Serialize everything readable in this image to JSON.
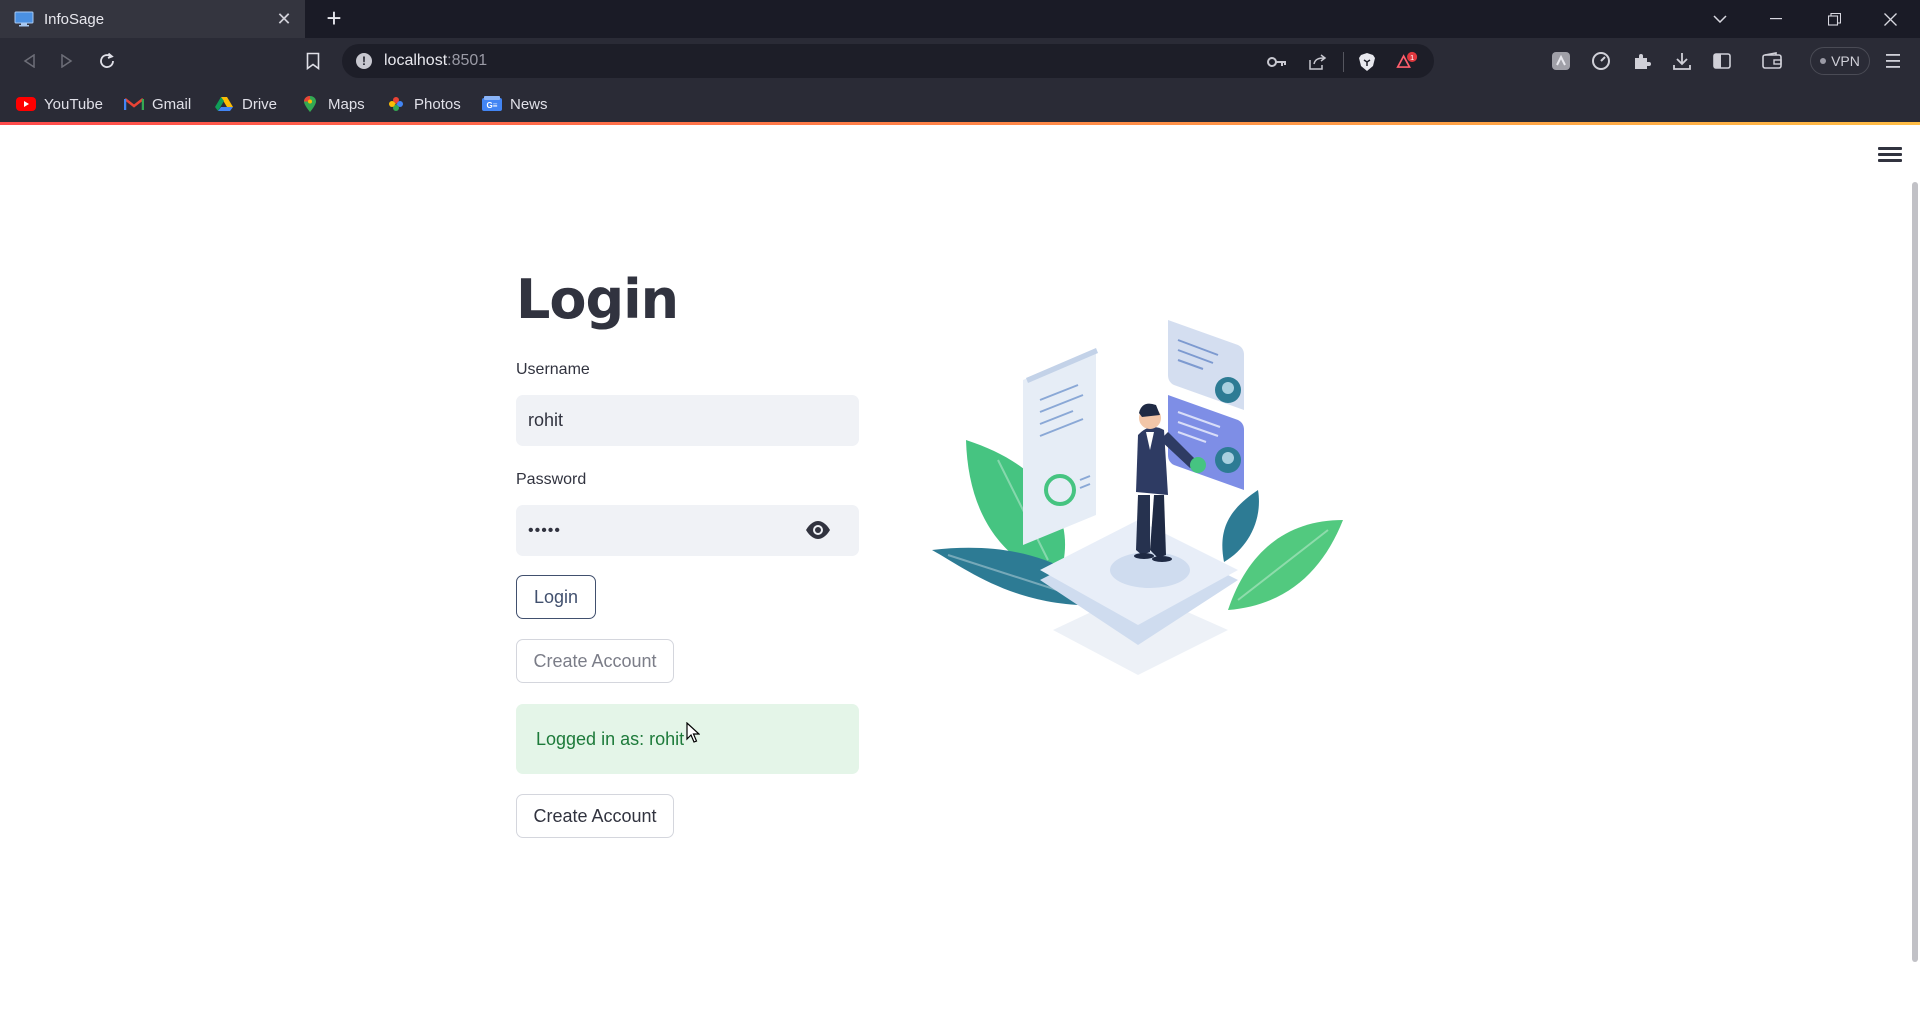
{
  "browser": {
    "tab_title": "InfoSage",
    "tab_close": "✕",
    "new_tab": "+",
    "url_host": "localhost",
    "url_port": ":8501",
    "vpn_label": "VPN",
    "shields_badge": "1"
  },
  "bookmarks": [
    {
      "label": "YouTube",
      "icon": "youtube-icon"
    },
    {
      "label": "Gmail",
      "icon": "gmail-icon"
    },
    {
      "label": "Drive",
      "icon": "drive-icon"
    },
    {
      "label": "Maps",
      "icon": "maps-icon"
    },
    {
      "label": "Photos",
      "icon": "photos-icon"
    },
    {
      "label": "News",
      "icon": "news-icon"
    }
  ],
  "login": {
    "title": "Login",
    "username_label": "Username",
    "username_value": "rohit",
    "password_label": "Password",
    "password_value": "•••••",
    "login_button": "Login",
    "create_account_button": "Create Account",
    "success_message": "Logged in as: rohit",
    "create_account_button_2": "Create Account"
  },
  "colors": {
    "accent_red": "#ff4b4b",
    "success_bg": "#e4f5e8",
    "success_text": "#1d7a3a",
    "input_bg": "#f0f2f6",
    "text": "#31333f"
  }
}
